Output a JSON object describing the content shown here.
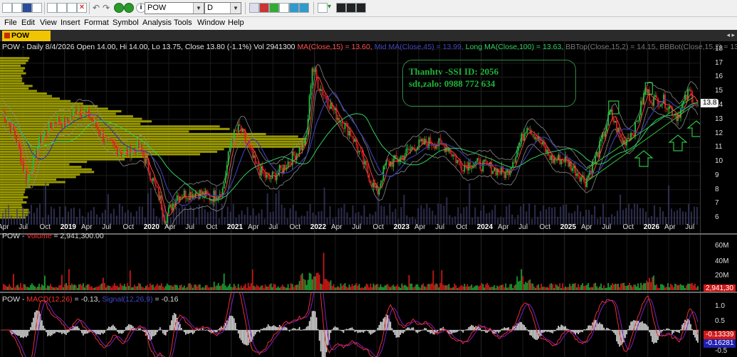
{
  "symbol_combo": "POW",
  "period_combo": "D",
  "menu": [
    "File",
    "Edit",
    "View",
    "Insert",
    "Format",
    "Symbol",
    "Analysis",
    "Tools",
    "Window",
    "Help"
  ],
  "tab_label": "POW (Daily)",
  "price_panel": {
    "header_prefix": "POW - Daily 8/4/2026 Open 14.00, Hi 14.00, Lo 13.75, Close 13.80 (-1.1%) Vol 2941300",
    "ma15_label": "MA(Close,15) = 13.60,",
    "ma45_label": "Mid MA(Close,45) = 13.99,",
    "ma100_label": "Long MA(Close,100) = 13.63,",
    "bbtop_label": "BBTop(Close,15,2) = 14.15,",
    "bbbot_label": "BBBot(Close,15,2) = 13.0",
    "price_tag": "13.8",
    "y_ticks": [
      "18",
      "17",
      "16",
      "15",
      "14",
      "13",
      "12",
      "11",
      "10",
      "9",
      "8",
      "7",
      "6"
    ],
    "note_line1": "Thanhtv -SSI ID: 2056",
    "note_line2": "sdt,zalo:  0988 772 634"
  },
  "x_axis": [
    {
      "t": "Apr",
      "y": false
    },
    {
      "t": "Jul",
      "y": false
    },
    {
      "t": "Oct",
      "y": false
    },
    {
      "t": "2019",
      "y": true
    },
    {
      "t": "Apr",
      "y": false
    },
    {
      "t": "Jul",
      "y": false
    },
    {
      "t": "Oct",
      "y": false
    },
    {
      "t": "2020",
      "y": true
    },
    {
      "t": "Apr",
      "y": false
    },
    {
      "t": "Jul",
      "y": false
    },
    {
      "t": "Oct",
      "y": false
    },
    {
      "t": "2021",
      "y": true
    },
    {
      "t": "Apr",
      "y": false
    },
    {
      "t": "Jul",
      "y": false
    },
    {
      "t": "Oct",
      "y": false
    },
    {
      "t": "2022",
      "y": true
    },
    {
      "t": "Apr",
      "y": false
    },
    {
      "t": "Jul",
      "y": false
    },
    {
      "t": "Oct",
      "y": false
    },
    {
      "t": "2023",
      "y": true
    },
    {
      "t": "Apr",
      "y": false
    },
    {
      "t": "Jul",
      "y": false
    },
    {
      "t": "Oct",
      "y": false
    },
    {
      "t": "2024",
      "y": true
    },
    {
      "t": "Apr",
      "y": false
    },
    {
      "t": "Jul",
      "y": false
    },
    {
      "t": "Oct",
      "y": false
    },
    {
      "t": "2025",
      "y": true
    },
    {
      "t": "Apr",
      "y": false
    },
    {
      "t": "Jul",
      "y": false
    },
    {
      "t": "Oct",
      "y": false
    },
    {
      "t": "2026",
      "y": true
    },
    {
      "t": "Apr",
      "y": false
    },
    {
      "t": "Jul",
      "y": false
    }
  ],
  "volume_panel": {
    "header_prefix": "POW -",
    "label": "Volume",
    "value": "= 2,941,300.00",
    "y_ticks": [
      "60M",
      "40M",
      "20M"
    ],
    "tag": "2,941,30"
  },
  "macd_panel": {
    "header_prefix": "POW -",
    "macd_label": "MACD(12,26)",
    "macd_value": "= -0.13,",
    "signal_label": "Signal(12,26,9)",
    "signal_value": "= -0.16",
    "y_ticks": [
      "1.0",
      "0.5",
      "0",
      "-0.5"
    ],
    "macd_tag": "-0.13339",
    "signal_tag": "-0.16281"
  },
  "colors": {
    "up": "#22c040",
    "down": "#e02020",
    "volume_profile": "#b3b300",
    "ma15": "#ff4040",
    "ma45": "#3a3aa8",
    "ma100": "#30d060",
    "bb": "#888888",
    "macd": "#e83030",
    "signal": "#8020c0",
    "note": "#1fb33a"
  },
  "chart_data": {
    "type": "candlestick",
    "symbol": "POW",
    "interval": "Daily",
    "last_bar": {
      "date": "8/4/2026",
      "open": 14.0,
      "high": 14.0,
      "low": 13.75,
      "close": 13.8,
      "change_pct": -1.1,
      "volume": 2941300
    },
    "y_range": [
      5.5,
      18.2
    ],
    "x_range_years": [
      2018.25,
      2026.6
    ],
    "price_path": [
      [
        2018.25,
        13.5
      ],
      [
        2018.4,
        12.0
      ],
      [
        2018.55,
        8.6
      ],
      [
        2018.7,
        11.5
      ],
      [
        2018.9,
        13.0
      ],
      [
        2019.0,
        12.6
      ],
      [
        2019.15,
        13.8
      ],
      [
        2019.3,
        13.2
      ],
      [
        2019.5,
        11.4
      ],
      [
        2019.7,
        10.6
      ],
      [
        2019.9,
        11.0
      ],
      [
        2020.0,
        9.6
      ],
      [
        2020.15,
        7.2
      ],
      [
        2020.2,
        5.9
      ],
      [
        2020.35,
        7.6
      ],
      [
        2020.6,
        7.8
      ],
      [
        2020.75,
        7.4
      ],
      [
        2020.9,
        8.0
      ],
      [
        2021.0,
        11.6
      ],
      [
        2021.1,
        12.4
      ],
      [
        2021.3,
        9.6
      ],
      [
        2021.45,
        8.7
      ],
      [
        2021.6,
        9.4
      ],
      [
        2021.75,
        10.4
      ],
      [
        2021.9,
        11.5
      ],
      [
        2021.97,
        16.8
      ],
      [
        2022.05,
        15.4
      ],
      [
        2022.25,
        13.4
      ],
      [
        2022.45,
        11.9
      ],
      [
        2022.6,
        9.7
      ],
      [
        2022.75,
        7.7
      ],
      [
        2022.85,
        9.8
      ],
      [
        2023.0,
        10.1
      ],
      [
        2023.2,
        11.1
      ],
      [
        2023.4,
        11.4
      ],
      [
        2023.6,
        11.0
      ],
      [
        2023.75,
        9.7
      ],
      [
        2023.9,
        9.9
      ],
      [
        2024.1,
        9.6
      ],
      [
        2024.3,
        9.1
      ],
      [
        2024.45,
        11.0
      ],
      [
        2024.55,
        12.7
      ],
      [
        2024.7,
        11.4
      ],
      [
        2024.85,
        10.1
      ],
      [
        2025.0,
        10.2
      ],
      [
        2025.25,
        8.6
      ],
      [
        2025.4,
        10.6
      ],
      [
        2025.55,
        13.5
      ],
      [
        2025.7,
        11.3
      ],
      [
        2025.85,
        12.4
      ],
      [
        2025.97,
        15.1
      ],
      [
        2026.05,
        14.4
      ],
      [
        2026.2,
        14.3
      ],
      [
        2026.35,
        13.2
      ],
      [
        2026.5,
        15.0
      ],
      [
        2026.6,
        13.8
      ]
    ],
    "volume_y_range": [
      0,
      75000000
    ],
    "macd_last": -0.13,
    "signal_last": -0.16,
    "indicators": {
      "MA15": 13.6,
      "MA45": 13.99,
      "MA100": 13.63,
      "BBTop": 14.15,
      "BBBot": 13.0
    }
  }
}
